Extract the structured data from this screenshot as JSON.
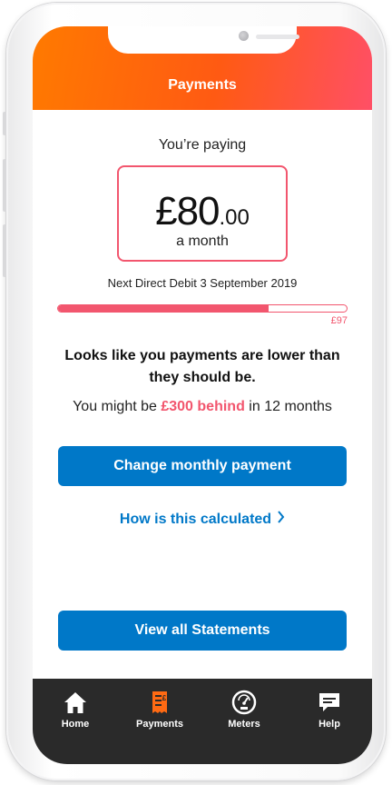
{
  "header": {
    "title": "Payments"
  },
  "summary": {
    "intro": "You’re paying",
    "amount_main": "£80",
    "amount_decimal": ".00",
    "period": "a month",
    "next_debit": "Next Direct Debit 3 September 2019"
  },
  "progress": {
    "fraction": 0.73,
    "label": "£97"
  },
  "warning": {
    "headline": "Looks like you payments are lower than they should be.",
    "prefix": "You might be",
    "highlight": "£300 behind",
    "suffix": "in 12 months"
  },
  "actions": {
    "change_payment": "Change monthly payment",
    "how_calculated": "How is this calculated",
    "view_statements": "View all Statements"
  },
  "tabs": [
    {
      "label": "Home",
      "icon": "home-icon",
      "active": false
    },
    {
      "label": "Payments",
      "icon": "payments-icon",
      "active": true
    },
    {
      "label": "Meters",
      "icon": "meter-gauge-icon",
      "active": false
    },
    {
      "label": "Help",
      "icon": "chat-bubble-icon",
      "active": false
    }
  ],
  "colors": {
    "accent": "#f2566e",
    "primary_button": "#0078c8",
    "active_tab_icon": "#ff6a13",
    "tabbar": "#2a2a2a"
  }
}
